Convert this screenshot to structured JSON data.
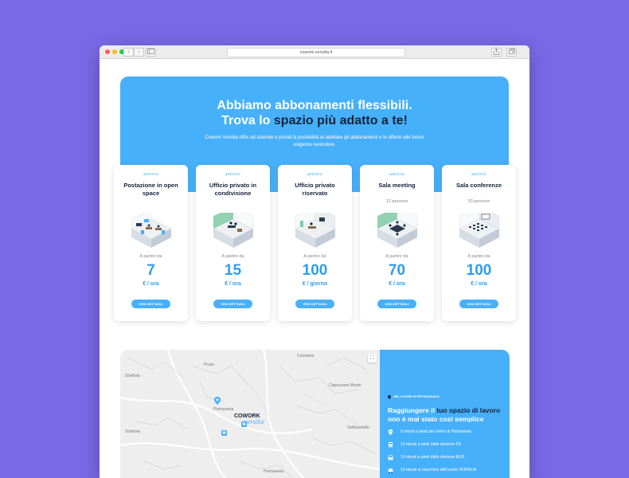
{
  "browser": {
    "url": "cowork-versilia.it",
    "back": "‹",
    "forward": "›"
  },
  "hero": {
    "title_line1": "Abbiamo abbonamenti flessibili.",
    "title_line2_a": "Trova lo ",
    "title_line2_b": "spazio più adatto a te!",
    "subtitle": "Cowork Versilia offre ad aziende e privati la possibilità di adattare gli abbonamenti e le offerte alle future esigenze lavorative."
  },
  "cards": [
    {
      "tag": "AFFITTO",
      "title": "Postazione in open space",
      "subtitle": "",
      "from": "A partire da",
      "price": "7",
      "unit": "€ / ora",
      "button": "VEDI DETTAGLI",
      "image_icon": "open-space-illustration-icon"
    },
    {
      "tag": "AFFITTO",
      "title": "Ufficio privato in condivisione",
      "subtitle": "",
      "from": "A partire da",
      "price": "15",
      "unit": "€ / ora",
      "button": "VEDI DETTAGLI",
      "image_icon": "shared-office-illustration-icon"
    },
    {
      "tag": "AFFITTO",
      "title": "Ufficio privato riservato",
      "subtitle": "",
      "from": "A partire da",
      "price": "100",
      "unit": "€ / giorno",
      "button": "VEDI DETTAGLI",
      "image_icon": "private-office-illustration-icon"
    },
    {
      "tag": "AFFITTO",
      "title": "Sala meeting",
      "subtitle": "12 persone",
      "from": "A partire da",
      "price": "70",
      "unit": "€ / ora",
      "button": "VEDI DETTAGLI",
      "image_icon": "meeting-room-illustration-icon"
    },
    {
      "tag": "AFFITTO",
      "title": "Sala conferenze",
      "subtitle": "50 persone",
      "from": "A partire da",
      "price": "100",
      "unit": "€ / ora",
      "button": "VEDI DETTAGLI",
      "image_icon": "conference-room-illustration-icon"
    }
  ],
  "map": {
    "labels": [
      "Camaiore",
      "Pietrasanta",
      "Capezzano Monte",
      "Pruno",
      "Strettoia",
      "Valdicastello",
      "Strettoia",
      "Pietrasanta"
    ],
    "brand_logo_line1": "COWORK",
    "brand_logo_line2": "versilia",
    "fullscreen_icon": "fullscreen-icon"
  },
  "location": {
    "tag": "NEL CUORE DI PIETRASANTA",
    "title_a": "Raggiungere il ",
    "title_b": "tuo spazio di lavoro",
    "title_c": " non è mai stato così semplice",
    "items": [
      {
        "icon": "map-pin-icon",
        "text": "5 minuti a piedi dal centro di Pietrasanta"
      },
      {
        "icon": "train-icon",
        "text": "10 minuti a piedi dalla stazione FS"
      },
      {
        "icon": "bus-icon",
        "text": "10 minuti a piedi dalla stazione BUS"
      },
      {
        "icon": "car-icon",
        "text": "10 minuti in macchina dall'uscita VERSILIA"
      }
    ]
  },
  "colors": {
    "accent": "#47b0fb",
    "dark": "#15233a",
    "background": "#7b68e6"
  }
}
